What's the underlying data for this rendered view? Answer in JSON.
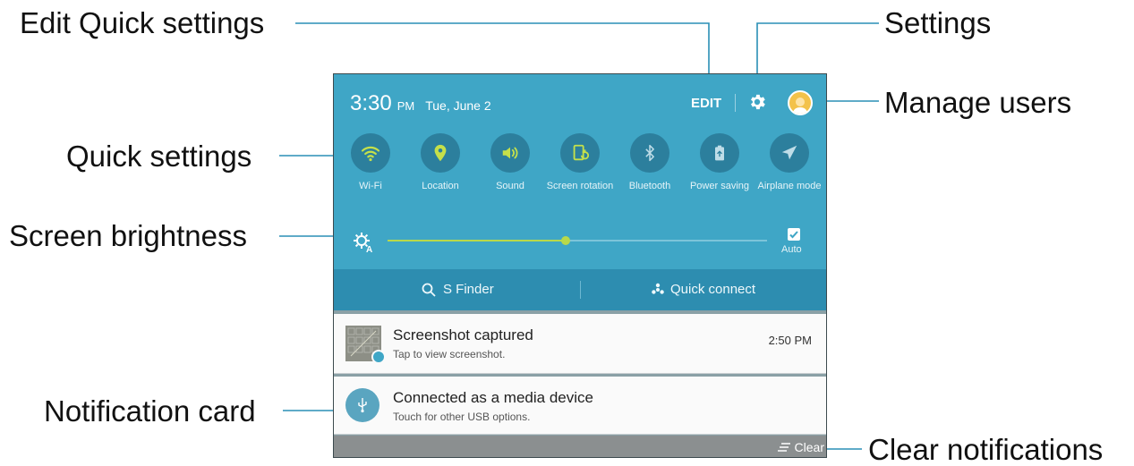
{
  "callouts": {
    "edit_quick_settings": "Edit Quick settings",
    "settings": "Settings",
    "manage_users": "Manage users",
    "quick_settings": "Quick settings",
    "screen_brightness": "Screen brightness",
    "notification_card": "Notification card",
    "clear_notifications": "Clear notifications"
  },
  "status": {
    "time": "3:30",
    "ampm": "PM",
    "date": "Tue, June 2"
  },
  "header": {
    "edit_label": "EDIT"
  },
  "tiles": [
    {
      "label": "Wi-Fi",
      "icon": "wifi-icon"
    },
    {
      "label": "Location",
      "icon": "location-icon"
    },
    {
      "label": "Sound",
      "icon": "sound-icon"
    },
    {
      "label": "Screen rotation",
      "icon": "screen-rotation-icon"
    },
    {
      "label": "Bluetooth",
      "icon": "bluetooth-icon"
    },
    {
      "label": "Power saving",
      "icon": "power-saving-icon"
    },
    {
      "label": "Airplane mode",
      "icon": "airplane-icon"
    }
  ],
  "brightness": {
    "level": 0.47,
    "auto_label": "Auto",
    "auto_checked": true
  },
  "finder_bar": {
    "s_finder": "S Finder",
    "quick_connect": "Quick connect"
  },
  "notifications": [
    {
      "title": "Screenshot captured",
      "subtitle": "Tap to view screenshot.",
      "time": "2:50 PM"
    },
    {
      "title": "Connected as a media device",
      "subtitle": "Touch for other USB options."
    }
  ],
  "footer": {
    "clear_label": "Clear"
  },
  "colors": {
    "panel_blue": "#3fa6c6",
    "tile_circle": "#2c7f9d",
    "active_icon": "#c5e04a",
    "finder_bar": "#2d8db0"
  }
}
